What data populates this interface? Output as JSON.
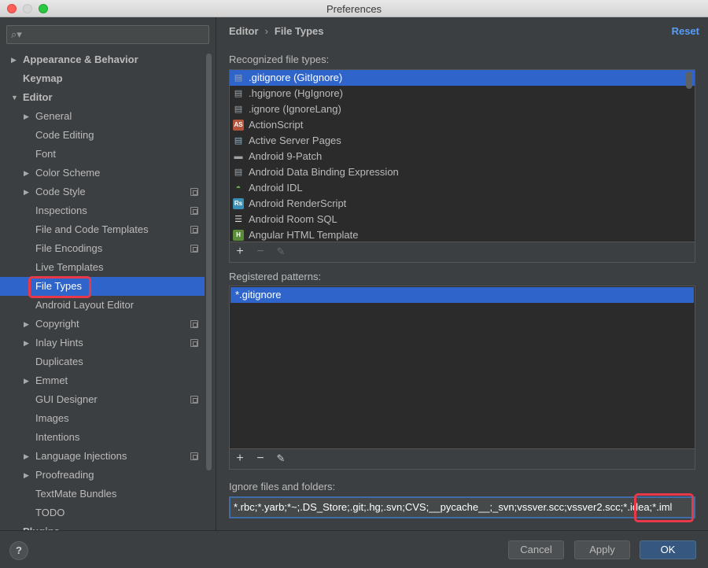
{
  "window": {
    "title": "Preferences"
  },
  "search": {
    "placeholder": ""
  },
  "sidebar": {
    "items": [
      {
        "label": "Appearance & Behavior",
        "level": 0,
        "arrow": "right",
        "bold": true
      },
      {
        "label": "Keymap",
        "level": 0,
        "arrow": "none",
        "bold": true
      },
      {
        "label": "Editor",
        "level": 0,
        "arrow": "down",
        "bold": true
      },
      {
        "label": "General",
        "level": 1,
        "arrow": "right"
      },
      {
        "label": "Code Editing",
        "level": 1,
        "arrow": "none"
      },
      {
        "label": "Font",
        "level": 1,
        "arrow": "none"
      },
      {
        "label": "Color Scheme",
        "level": 1,
        "arrow": "right"
      },
      {
        "label": "Code Style",
        "level": 1,
        "arrow": "right",
        "project": true
      },
      {
        "label": "Inspections",
        "level": 1,
        "arrow": "none",
        "project": true
      },
      {
        "label": "File and Code Templates",
        "level": 1,
        "arrow": "none",
        "project": true
      },
      {
        "label": "File Encodings",
        "level": 1,
        "arrow": "none",
        "project": true
      },
      {
        "label": "Live Templates",
        "level": 1,
        "arrow": "none"
      },
      {
        "label": "File Types",
        "level": 1,
        "arrow": "none",
        "selected": true
      },
      {
        "label": "Android Layout Editor",
        "level": 1,
        "arrow": "none"
      },
      {
        "label": "Copyright",
        "level": 1,
        "arrow": "right",
        "project": true
      },
      {
        "label": "Inlay Hints",
        "level": 1,
        "arrow": "right",
        "project": true
      },
      {
        "label": "Duplicates",
        "level": 1,
        "arrow": "none"
      },
      {
        "label": "Emmet",
        "level": 1,
        "arrow": "right"
      },
      {
        "label": "GUI Designer",
        "level": 1,
        "arrow": "none",
        "project": true
      },
      {
        "label": "Images",
        "level": 1,
        "arrow": "none"
      },
      {
        "label": "Intentions",
        "level": 1,
        "arrow": "none"
      },
      {
        "label": "Language Injections",
        "level": 1,
        "arrow": "right",
        "project": true
      },
      {
        "label": "Proofreading",
        "level": 1,
        "arrow": "right"
      },
      {
        "label": "TextMate Bundles",
        "level": 1,
        "arrow": "none"
      },
      {
        "label": "TODO",
        "level": 1,
        "arrow": "none"
      },
      {
        "label": "Plugins",
        "level": 0,
        "arrow": "none",
        "bold": true
      }
    ]
  },
  "breadcrumb": {
    "parent": "Editor",
    "separator": "›",
    "current": "File Types"
  },
  "reset_label": "Reset",
  "recognized": {
    "label": "Recognized file types:",
    "items": [
      {
        "label": ".gitignore (GitIgnore)",
        "icon": "gitignore-icon",
        "selected": true
      },
      {
        "label": ".hgignore (HgIgnore)",
        "icon": "hgignore-icon"
      },
      {
        "label": ".ignore (IgnoreLang)",
        "icon": "ignore-icon"
      },
      {
        "label": "ActionScript",
        "icon": "actionscript-icon"
      },
      {
        "label": "Active Server Pages",
        "icon": "asp-icon"
      },
      {
        "label": "Android 9-Patch",
        "icon": "folder-icon"
      },
      {
        "label": "Android Data Binding Expression",
        "icon": "databinding-icon"
      },
      {
        "label": "Android IDL",
        "icon": "android-icon"
      },
      {
        "label": "Android RenderScript",
        "icon": "renderscript-icon"
      },
      {
        "label": "Android Room SQL",
        "icon": "sql-icon"
      },
      {
        "label": "Angular HTML Template",
        "icon": "html-icon"
      }
    ]
  },
  "patterns": {
    "label": "Registered patterns:",
    "items": [
      "*.gitignore"
    ]
  },
  "ignore": {
    "label": "Ignore files and folders:",
    "value": "*.rbc;*.yarb;*~;.DS_Store;.git;.hg;.svn;CVS;__pycache__;_svn;vssver.scc;vssver2.scc;*.idea;*.iml"
  },
  "toolbar_icons": {
    "add": "+",
    "remove": "−",
    "edit": "✎"
  },
  "footer": {
    "help": "?",
    "cancel": "Cancel",
    "apply": "Apply",
    "ok": "OK"
  },
  "colors": {
    "selection": "#2f65ca",
    "highlight_box": "#e8394a",
    "link": "#589df6"
  }
}
